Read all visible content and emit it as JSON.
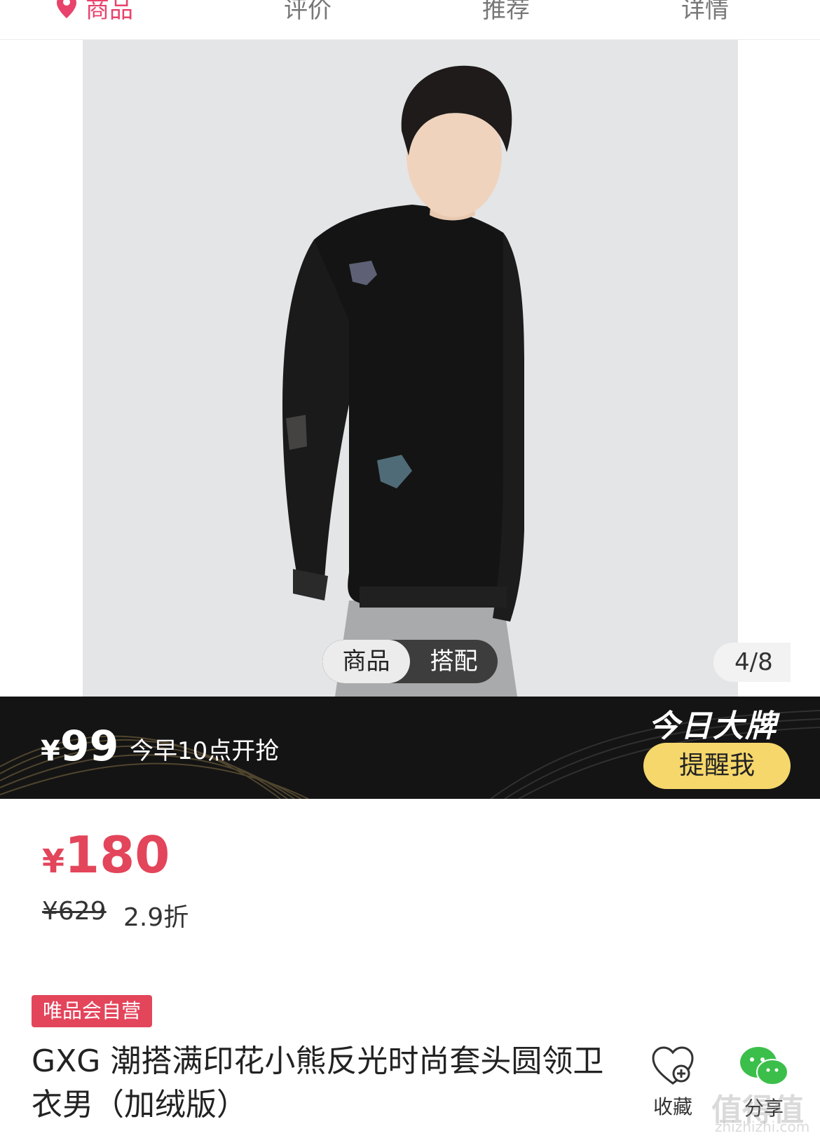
{
  "nav": {
    "tabs": [
      "商品",
      "评价",
      "推荐",
      "详情"
    ],
    "active_index": 0,
    "accent": "#e8436c"
  },
  "gallery": {
    "segment": [
      "商品",
      "搭配"
    ],
    "counter": "4/8"
  },
  "flash_sale": {
    "currency": "¥",
    "price": "99",
    "time_text": "今早10点开抢",
    "brand_label": "今日大牌",
    "remind_button": "提醒我",
    "button_color": "#f5d76b"
  },
  "price": {
    "currency": "¥",
    "current": "180",
    "original": "¥629",
    "discount": "2.9折",
    "color": "#e3455b"
  },
  "product": {
    "badge": "唯品会自营",
    "title": "GXG 潮搭满印花小熊反光时尚套头圆领卫衣男（加绒版）"
  },
  "actions": {
    "favorite_label": "收藏",
    "share_label": "分享",
    "favorite_icon": "heart-plus-icon",
    "share_icon": "wechat-icon"
  },
  "watermark": {
    "text": "值得值",
    "sub": "zhizhizhi.com"
  }
}
